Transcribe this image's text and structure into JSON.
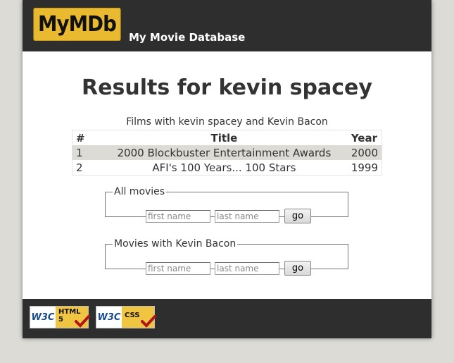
{
  "header": {
    "logo_text": "MyMDb",
    "tagline": "My Movie Database"
  },
  "main": {
    "title": "Results for kevin spacey",
    "table_caption": "Films with kevin spacey and Kevin Bacon",
    "columns": [
      "#",
      "Title",
      "Year"
    ],
    "rows": [
      {
        "num": "1",
        "title": "2000 Blockbuster Entertainment Awards",
        "year": "2000"
      },
      {
        "num": "2",
        "title": "AFI's 100 Years... 100 Stars",
        "year": "1999"
      }
    ]
  },
  "search_all": {
    "legend": "All movies",
    "first_placeholder": "first name",
    "last_placeholder": "last name",
    "go_label": "go"
  },
  "search_bacon": {
    "legend": "Movies with Kevin Bacon",
    "first_placeholder": "first name",
    "last_placeholder": "last name",
    "go_label": "go"
  },
  "footer": {
    "html_badge": {
      "w3c": "W3C",
      "kind": "HTML",
      "version": "5"
    },
    "css_badge": {
      "w3c": "W3C",
      "kind": "CSS"
    }
  },
  "colors": {
    "header_bg": "#2e2e2e",
    "logo_bg": "#e9b930",
    "page_bg": "#dcdbd6",
    "row_highlight": "#dcdbd6",
    "check_red": "#b01616"
  }
}
